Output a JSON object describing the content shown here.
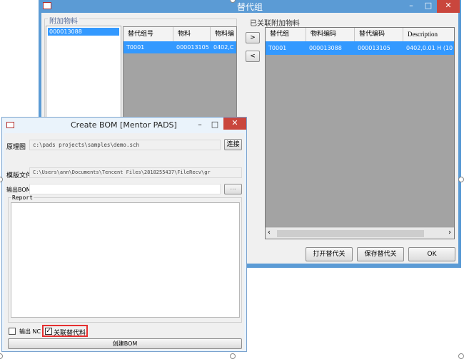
{
  "substitute_window": {
    "title": "替代组",
    "attach_group_title": "附加物料",
    "attach_list": [
      "000013088"
    ],
    "left_grid": {
      "headers": [
        "替代组号",
        "物料",
        "物料编"
      ],
      "rows": [
        [
          "T0001",
          "000013105",
          "0402,C"
        ]
      ]
    },
    "linked_label": "已关联附加物料",
    "linked_grid": {
      "headers": [
        "替代组",
        "物料编码",
        "替代编码",
        "Description"
      ],
      "rows": [
        [
          "T0001",
          "000013088",
          "000013105",
          "0402,0.01 H (10"
        ]
      ]
    },
    "add_arrow": ">",
    "remove_arrow": "<",
    "open_button": "打开替代关",
    "save_button": "保存替代关",
    "ok_button": "OK",
    "minimize": "–",
    "maximize": "□",
    "close": "✕"
  },
  "bom_window": {
    "title": "Create BOM  [Mentor PADS]",
    "schematic_label": "原理图",
    "schematic_value": "c:\\pads projects\\samples\\demo.sch",
    "connect_button": "连接",
    "template_label": "模版文件",
    "template_value": "C:\\Users\\ann\\Documents\\Tencent Files\\2818255437\\FileRecv\\gr",
    "output_label": "输出BOM",
    "output_value": "",
    "browse_button": "...",
    "report_label": "Report",
    "report_text": "",
    "output_nc_label": "输出 NC",
    "output_nc_checked": false,
    "link_substitute_label": "关联替代料",
    "link_substitute_checked": true,
    "create_button": "创建BOM",
    "minimize": "–",
    "maximize": "□",
    "close": "✕"
  },
  "colors": {
    "title_blue": "#5b9bd5",
    "selection_blue": "#3399ff",
    "grid_gray": "#a3a3a3",
    "close_red": "#c9463d",
    "highlight_red": "#e53030"
  }
}
